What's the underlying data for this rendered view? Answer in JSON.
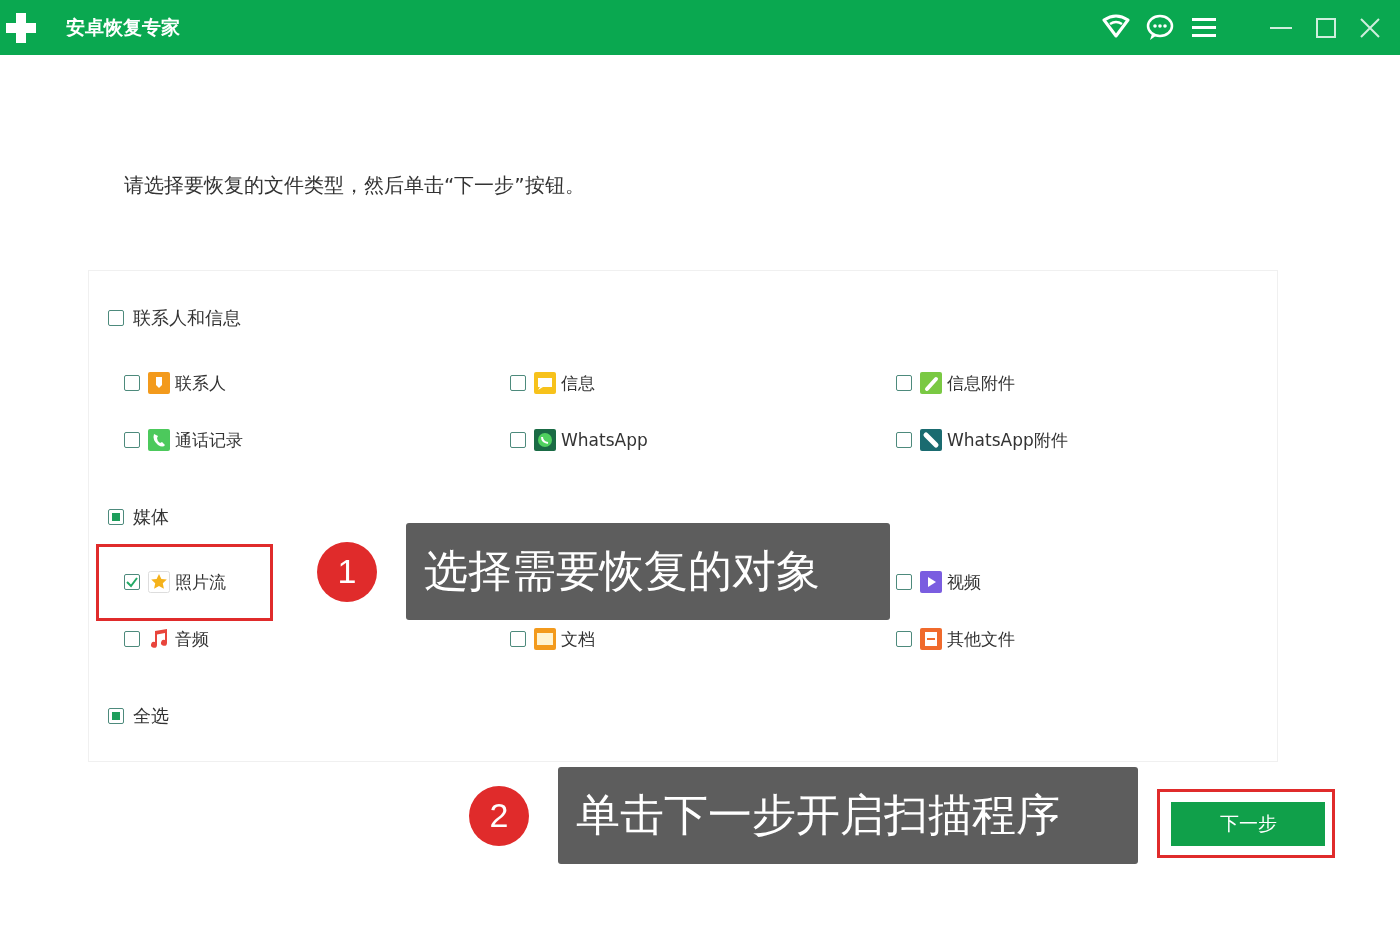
{
  "window": {
    "title": "安卓恢复专家"
  },
  "instruction": "请选择要恢复的文件类型，然后单击“下一步”按钮。",
  "groups": [
    {
      "label": "联系人和信息",
      "partial": false,
      "items": [
        {
          "label": "联系人",
          "kind": "contact",
          "checked": false
        },
        {
          "label": "信息",
          "kind": "message",
          "checked": false
        },
        {
          "label": "信息附件",
          "kind": "attachment",
          "checked": false
        },
        {
          "label": "通话记录",
          "kind": "phone",
          "checked": false
        },
        {
          "label": "WhatsApp",
          "kind": "whatsapp",
          "checked": false
        },
        {
          "label": "WhatsApp附件",
          "kind": "clip",
          "checked": false
        }
      ]
    },
    {
      "label": "媒体",
      "partial": true,
      "items": [
        {
          "label": "照片流",
          "kind": "star",
          "checked": true,
          "highlighted": true
        },
        {
          "kind": "hidden"
        },
        {
          "label": "视频",
          "kind": "video",
          "checked": false
        },
        {
          "label": "音频",
          "kind": "music",
          "checked": false
        },
        {
          "label": "文档",
          "kind": "document",
          "checked": false
        },
        {
          "label": "其他文件",
          "kind": "file",
          "checked": false
        }
      ]
    },
    {
      "label": "全选",
      "partial": true
    }
  ],
  "callouts": [
    {
      "number": "1",
      "text": "选择需要恢复的对象"
    },
    {
      "number": "2",
      "text": "单击下一步开启扫描程序"
    }
  ],
  "next_button": {
    "label": "下一步",
    "highlighted": true
  }
}
